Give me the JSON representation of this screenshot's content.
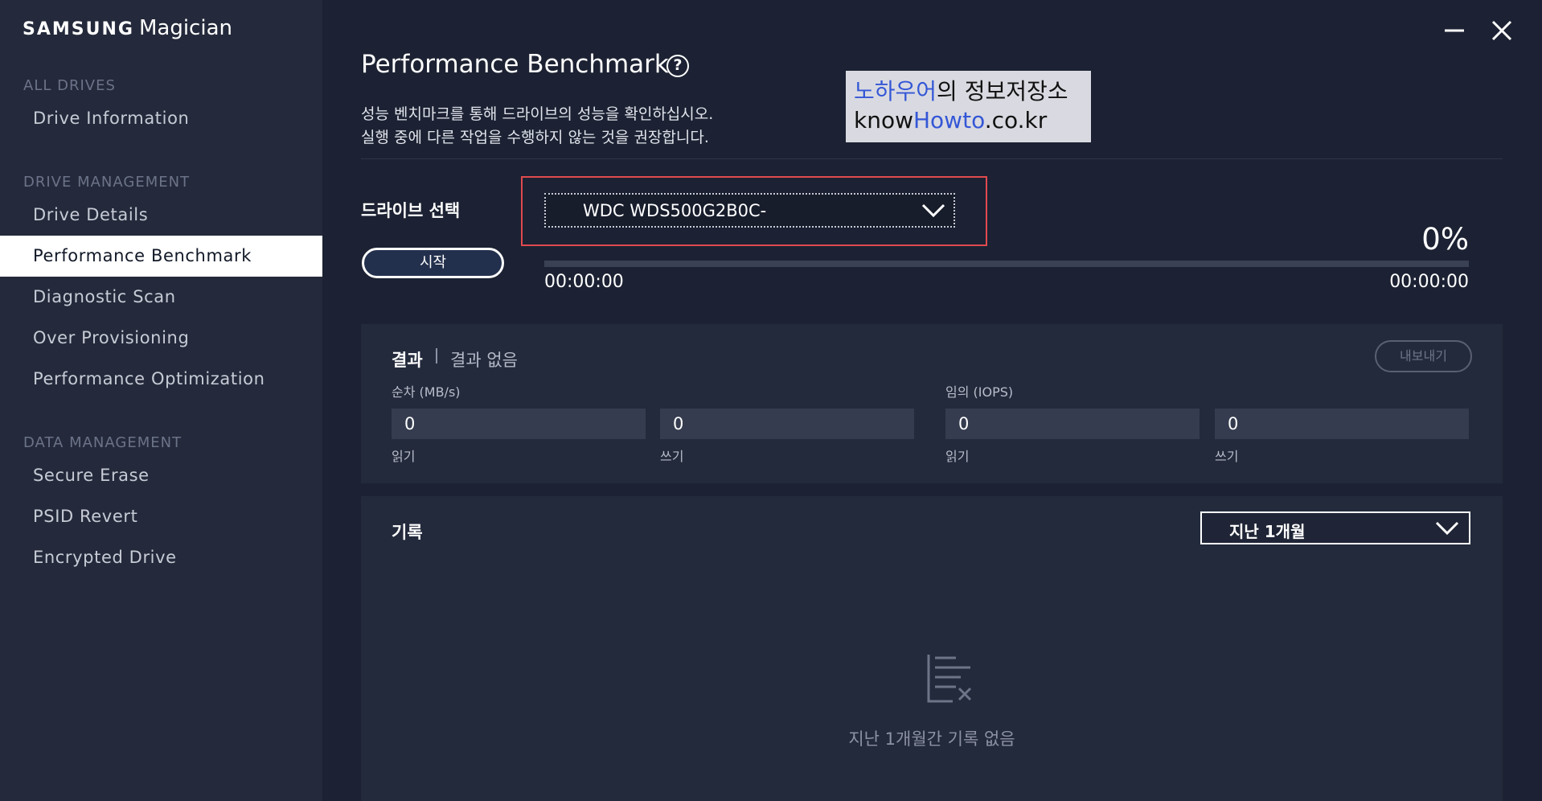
{
  "app": {
    "brand": "SAMSUNG",
    "product": "Magician"
  },
  "sidebar": {
    "all_drives": {
      "title": "ALL DRIVES",
      "items": [
        {
          "label": "Drive Information"
        }
      ]
    },
    "drive_management": {
      "title": "DRIVE MANAGEMENT",
      "items": [
        {
          "label": "Drive Details"
        },
        {
          "label": "Performance Benchmark",
          "active": true
        },
        {
          "label": "Diagnostic Scan"
        },
        {
          "label": "Over Provisioning"
        },
        {
          "label": "Performance Optimization"
        }
      ]
    },
    "data_management": {
      "title": "DATA MANAGEMENT",
      "items": [
        {
          "label": "Secure Erase"
        },
        {
          "label": "PSID Revert"
        },
        {
          "label": "Encrypted Drive"
        }
      ]
    }
  },
  "window": {
    "minimize_icon": "minimize-icon",
    "close_icon": "close-icon"
  },
  "page": {
    "title": "Performance Benchmark",
    "help_icon": "question-circle-icon",
    "help_glyph": "?",
    "description_line1": "성능 벤치마크를 통해 드라이브의 성능을 확인하십시오.",
    "description_line2": "실행 중에 다른 작업을 수행하지 않는 것을 권장합니다."
  },
  "watermark": {
    "line1_blue": "노하우어",
    "line1_rest": "의 정보저장소",
    "line2_a": "know",
    "line2_blue": "Howto",
    "line2_b": ".co.kr"
  },
  "benchmark": {
    "drive_select_label": "드라이브 선택",
    "selected_drive": "WDC WDS500G2B0C-",
    "start_button": "시작",
    "progress_percent_text": "0%",
    "progress_fraction": 0,
    "elapsed_time": "00:00:00",
    "remaining_time": "00:00:00"
  },
  "results": {
    "title": "결과",
    "status": "결과 없음",
    "export_button": "내보내기",
    "sequential": {
      "label": "순차 (MB/s)",
      "read_value": "0",
      "read_label": "읽기",
      "write_value": "0",
      "write_label": "쓰기"
    },
    "random": {
      "label": "임의 (IOPS)",
      "read_value": "0",
      "read_label": "읽기",
      "write_value": "0",
      "write_label": "쓰기"
    }
  },
  "history": {
    "title": "기록",
    "period": "지난 1개월",
    "empty_icon": "empty-list-icon",
    "empty_text": "지난 1개월간 기록 없음"
  },
  "colors": {
    "accent_progress": "#5f8cff",
    "highlight_box": "#e04a4f",
    "sidebar_active_bg": "#ffffff"
  }
}
